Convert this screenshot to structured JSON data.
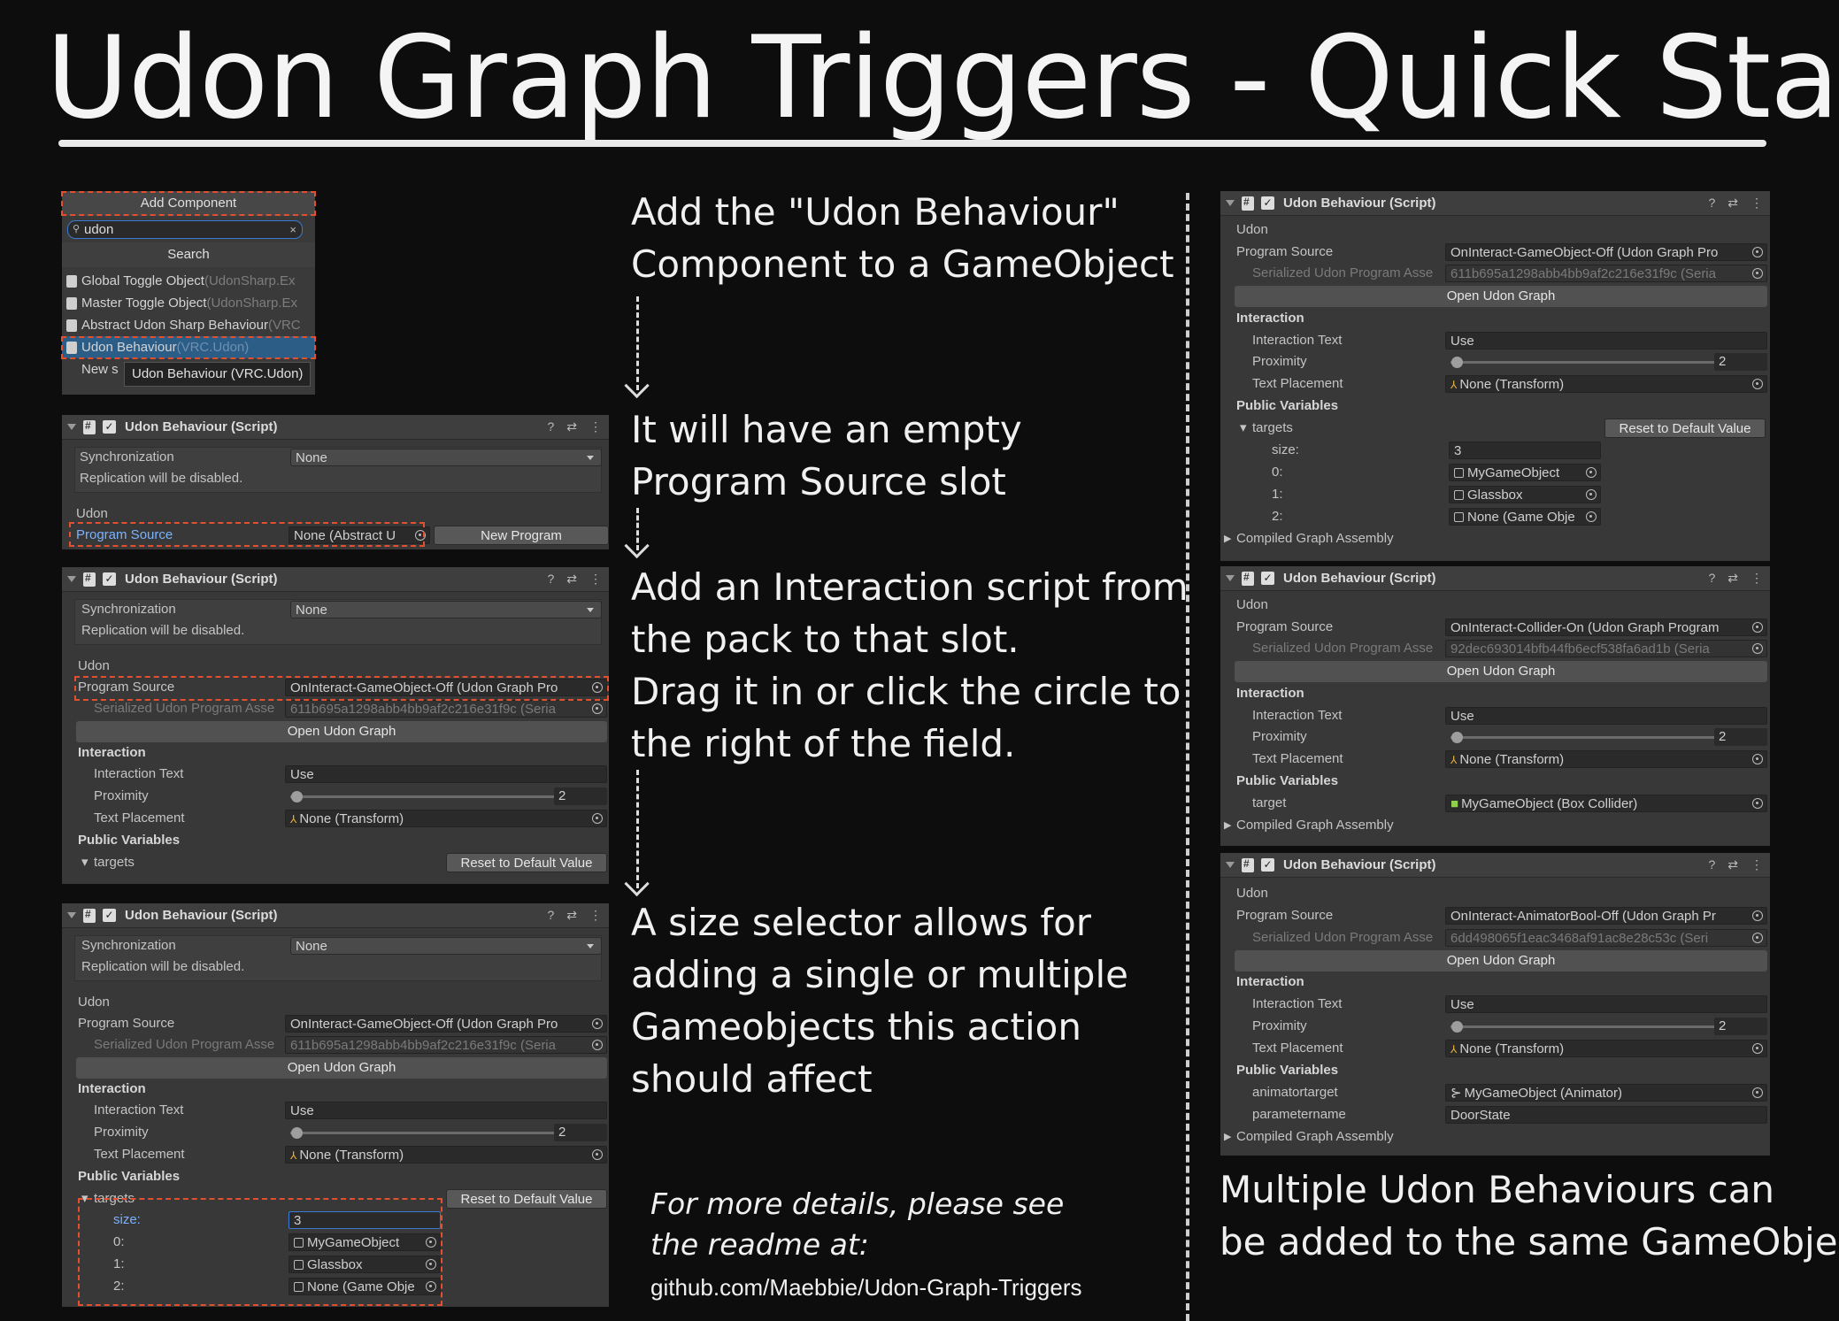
{
  "title": "Udon Graph Triggers - Quick Start",
  "steps": {
    "s1": [
      "Add the \"Udon Behaviour\"",
      "Component to a GameObject"
    ],
    "s2": [
      "It will have an empty",
      "Program Source slot"
    ],
    "s3": [
      "Add an Interaction script from",
      "the pack to that slot.",
      "Drag it in or click the circle to",
      "the right of the field."
    ],
    "s4": [
      "A size selector allows for",
      "adding a single or multiple",
      "Gameobjects this action",
      "should affect"
    ]
  },
  "readme": {
    "line1": "For more details, please see",
    "line2": "the readme at:",
    "url": "github.com/Maebbie/Udon-Graph-Triggers"
  },
  "multi_note": [
    "Multiple Udon Behaviours can",
    "be added to the same GameObject!"
  ],
  "add_component": {
    "header": "Add Component",
    "search_value": "udon",
    "category": "Search",
    "items": [
      {
        "name": "Global Toggle Object",
        "ns": "(UdonSharp.Ex"
      },
      {
        "name": "Master Toggle Object",
        "ns": "(UdonSharp.Ex"
      },
      {
        "name": "Abstract Udon Sharp Behaviour",
        "ns": "(VRC"
      },
      {
        "name": "Udon Behaviour",
        "ns": "(VRC.Udon)"
      },
      {
        "name": "New s",
        "ns": ""
      }
    ],
    "tooltip": "Udon Behaviour (VRC.Udon)"
  },
  "ui": {
    "script_title": "Udon Behaviour (Script)",
    "sync_label": "Synchronization",
    "sync_value": "None",
    "replication": "Replication will be disabled.",
    "udon": "Udon",
    "program_source": "Program Source",
    "serialized": "Serialized Udon Program Asse",
    "open_graph": "Open Udon Graph",
    "interaction": "Interaction",
    "interaction_text": "Interaction Text",
    "use": "Use",
    "proximity": "Proximity",
    "proximity_value": "2",
    "text_placement": "Text Placement",
    "none_transform": "None (Transform)",
    "public_variables": "Public Variables",
    "targets": "targets",
    "reset": "Reset to Default Value",
    "size": "size:",
    "size_value": "3",
    "i0": "0:",
    "i1": "1:",
    "i2": "2:",
    "mygameobject": "MyGameObject",
    "glassbox": "Glassbox",
    "none_gameobj": "None (Game Obje",
    "compiled": "Compiled Graph Assembly",
    "none_abstract": "None (Abstract U",
    "new_program": "New Program",
    "src_off": "OnInteract-GameObject-Off (Udon Graph Pro",
    "hash1": "611b695a1298abb4bb9af2c216e31f9c (Seria",
    "src_collider": "OnInteract-Collider-On (Udon Graph Program",
    "hash2": "92dec693014bfb44fb6ecf538fa6ad1b (Seria",
    "target": "target",
    "box_collider": "MyGameObject (Box Collider)",
    "src_anim": "OnInteract-AnimatorBool-Off (Udon Graph Pr",
    "hash3": "6dd498065f1eac3468af91ac8e28c53c (Seri",
    "animatortarget": "animatortarget",
    "anim_value": "MyGameObject (Animator)",
    "parametername": "parametername",
    "param_value": "DoorState"
  }
}
